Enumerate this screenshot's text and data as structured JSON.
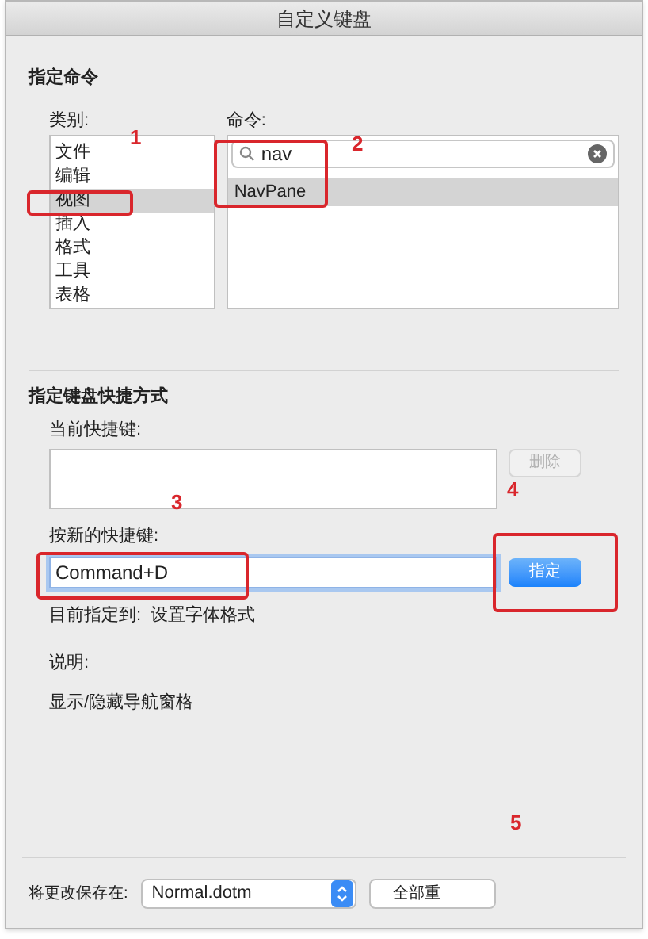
{
  "window": {
    "title": "自定义键盘"
  },
  "assign_command": {
    "heading": "指定命令",
    "categories_label": "类别:",
    "categories": [
      {
        "label": "文件",
        "selected": false
      },
      {
        "label": "编辑",
        "selected": false
      },
      {
        "label": "视图",
        "selected": true
      },
      {
        "label": "插入",
        "selected": false
      },
      {
        "label": "格式",
        "selected": false
      },
      {
        "label": "工具",
        "selected": false
      },
      {
        "label": "表格",
        "selected": false
      }
    ],
    "commands_label": "命令:",
    "search": {
      "value": "nav"
    },
    "commands": [
      {
        "label": "NavPane",
        "selected": true
      }
    ]
  },
  "shortcut": {
    "heading": "指定键盘快捷方式",
    "current_label": "当前快捷键:",
    "remove_button": {
      "label": "删除",
      "disabled": true
    },
    "new_label": "按新的快捷键:",
    "new_value": "Command+D",
    "assign_button": "指定",
    "assigned_label": "目前指定到:",
    "assigned_value": "设置字体格式",
    "description_label": "说明:",
    "description": "显示/隐藏导航窗格"
  },
  "footer": {
    "save_label": "将更改保存在:",
    "template": "Normal.dotm",
    "reset_button": "全部重"
  },
  "annotations": [
    {
      "label": "1",
      "kind": "boxed"
    },
    {
      "label": "2",
      "kind": "boxed"
    },
    {
      "label": "3",
      "kind": "boxed"
    },
    {
      "label": "4",
      "kind": "boxed"
    },
    {
      "label": "5",
      "kind": "plain"
    }
  ]
}
